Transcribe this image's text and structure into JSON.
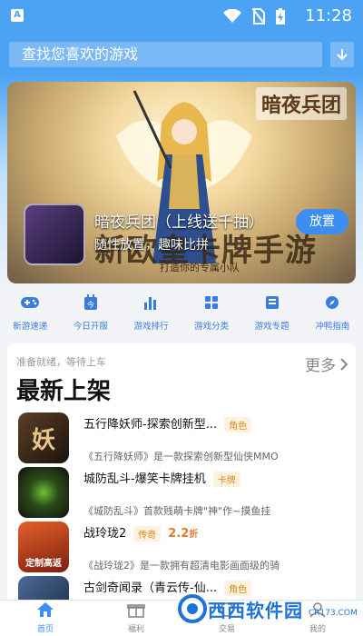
{
  "status_bar": {
    "app_badge": "A",
    "time": "11:28"
  },
  "search": {
    "placeholder": "查找您喜欢的游戏"
  },
  "banner": {
    "brand": "暗夜兵团",
    "slogan": "新欧皇卡牌手游",
    "sub_slogan": "打造你的专属小队",
    "game_title": "暗夜兵团（上线送千抽）",
    "game_desc": "随性放置，趣味比拼",
    "install_label": "放置"
  },
  "quick_nav": [
    {
      "label": "新游速递",
      "icon": "gamepad-icon"
    },
    {
      "label": "今日开服",
      "icon": "calendar-icon"
    },
    {
      "label": "游戏排行",
      "icon": "bar-chart-icon"
    },
    {
      "label": "游戏分类",
      "icon": "grid-icon"
    },
    {
      "label": "游戏专题",
      "icon": "list-icon"
    },
    {
      "label": "冲鸭指南",
      "icon": "compass-icon"
    }
  ],
  "latest": {
    "hint": "准备就绪，等待上车",
    "more": "更多",
    "title": "最新上架",
    "apps": [
      {
        "name": "五行降妖师-探索创新型...",
        "tag": "角色",
        "desc": "《五行降妖师》是一款探索创新型仙侠MMO",
        "icon_text": "妖",
        "color": "#3a2a1c"
      },
      {
        "name": "城防乱斗-爆笑卡牌挂机",
        "tag": "卡牌",
        "desc": "《城防乱斗》首款贱萌卡牌\"神\"作~摸鱼挂",
        "icon_text": "",
        "color": "#1e2b14"
      },
      {
        "name": "战玲珑2",
        "tag": "传奇",
        "discount": "2.2",
        "discount_unit": "折",
        "desc": "《战玲珑2》是一款拥有超清电影画面级的骑",
        "icon_text": "定制高返",
        "color": "#b5431e"
      },
      {
        "name": "古剑奇闻录（青云传-仙...",
        "tag": "角色",
        "desc": "",
        "icon_text": "",
        "color": "#2c3d5a"
      }
    ]
  },
  "tab_bar": [
    {
      "label": "首页",
      "icon": "home-icon",
      "active": true
    },
    {
      "label": "福利",
      "icon": "gift-icon",
      "active": false
    },
    {
      "label": "交易",
      "icon": "trade-icon",
      "active": false
    },
    {
      "label": "我的",
      "icon": "user-icon",
      "active": false
    }
  ],
  "watermark": {
    "logo": "西西软件园",
    "url": "CR173.COM"
  },
  "colors": {
    "primary": "#4da3f3",
    "accent": "#3c8ef2",
    "tag": "#d98c1e",
    "discount": "#e5782c"
  }
}
